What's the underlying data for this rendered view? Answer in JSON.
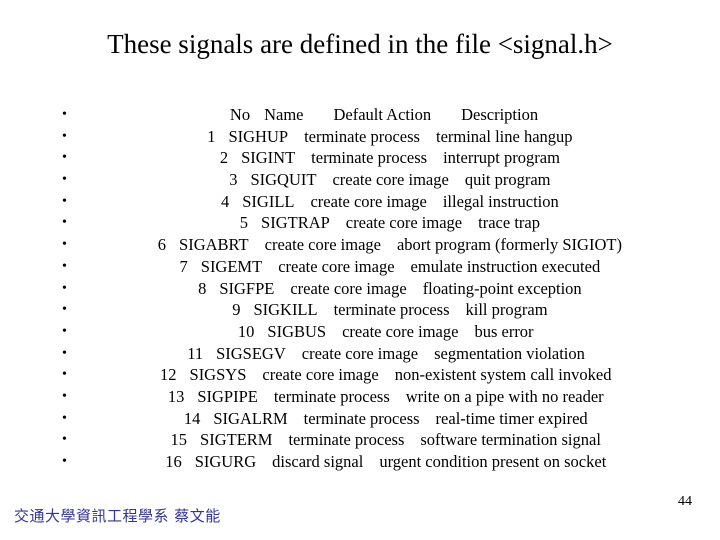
{
  "slide": {
    "title": "These signals are defined in the file <signal.h>",
    "page_number": "44",
    "footer_credit": "交通大學資訊工程學系 蔡文能",
    "bullet_glyph": "•",
    "text_color": "#000000",
    "footer_color": "#333399",
    "background_color": "#ffffff"
  },
  "table": {
    "headers": {
      "no": "No",
      "name": "Name",
      "action": "Default Action",
      "description": "Description"
    },
    "rows": [
      {
        "no": "1",
        "name": "SIGHUP",
        "action": "terminate process",
        "description": "terminal line hangup"
      },
      {
        "no": "2",
        "name": "SIGINT",
        "action": "terminate process",
        "description": "interrupt program"
      },
      {
        "no": "3",
        "name": "SIGQUIT",
        "action": "create core image",
        "description": "quit program"
      },
      {
        "no": "4",
        "name": "SIGILL",
        "action": "create core image",
        "description": "illegal instruction"
      },
      {
        "no": "5",
        "name": "SIGTRAP",
        "action": "create core image",
        "description": "trace trap"
      },
      {
        "no": "6",
        "name": "SIGABRT",
        "action": "create core image",
        "description": "abort program (formerly SIGIOT)"
      },
      {
        "no": "7",
        "name": "SIGEMT",
        "action": "create core image",
        "description": "emulate instruction executed"
      },
      {
        "no": "8",
        "name": "SIGFPE",
        "action": "create core image",
        "description": "floating-point exception"
      },
      {
        "no": "9",
        "name": "SIGKILL",
        "action": "terminate process",
        "description": "kill program"
      },
      {
        "no": "10",
        "name": "SIGBUS",
        "action": "create core image",
        "description": "bus error"
      },
      {
        "no": "11",
        "name": "SIGSEGV",
        "action": "create core image",
        "description": "segmentation violation"
      },
      {
        "no": "12",
        "name": "SIGSYS",
        "action": "create core image",
        "description": "non-existent system call invoked"
      },
      {
        "no": "13",
        "name": "SIGPIPE",
        "action": "terminate process",
        "description": "write on a pipe with no reader"
      },
      {
        "no": "14",
        "name": "SIGALRM",
        "action": "terminate process",
        "description": "real-time timer expired"
      },
      {
        "no": "15",
        "name": "SIGTERM",
        "action": "terminate process",
        "description": "software termination signal"
      },
      {
        "no": "16",
        "name": "SIGURG",
        "action": "discard signal",
        "description": "urgent condition present on socket"
      }
    ]
  }
}
